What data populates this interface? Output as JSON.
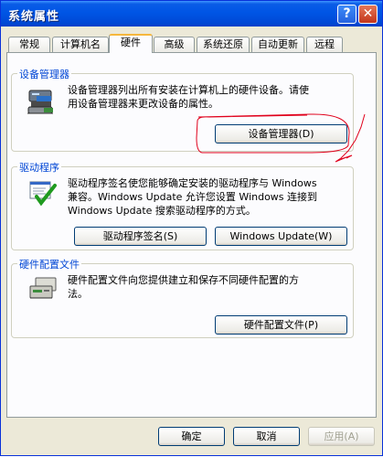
{
  "window": {
    "title": "系统属性",
    "help_glyph": "?",
    "close_glyph": "✕"
  },
  "tabs": [
    {
      "label": "常规"
    },
    {
      "label": "计算机名"
    },
    {
      "label": "硬件"
    },
    {
      "label": "高级"
    },
    {
      "label": "系统还原"
    },
    {
      "label": "自动更新"
    },
    {
      "label": "远程"
    }
  ],
  "active_tab": "硬件",
  "device_manager": {
    "title": "设备管理器",
    "description_line1": "设备管理器列出所有安装在计算机上的硬件设备。请使",
    "description_line2": "用设备管理器来更改设备的属性。",
    "button": "设备管理器(D)"
  },
  "drivers": {
    "title": "驱动程序",
    "description_line1": "驱动程序签名使您能够确定安装的驱动程序与 Windows",
    "description_line2": "兼容。Windows Update 允许您设置 Windows 连接到",
    "description_line3": "Windows Update 搜索驱动程序的方式。",
    "signing_button": "驱动程序签名(S)",
    "update_button": "Windows Update(W)"
  },
  "hardware_profiles": {
    "title": "硬件配置文件",
    "description_line1": "硬件配置文件向您提供建立和保存不同硬件配置的方",
    "description_line2": "法。",
    "button": "硬件配置文件(P)"
  },
  "footer": {
    "ok": "确定",
    "cancel": "取消",
    "apply": "应用(A)"
  },
  "colors": {
    "title_bar": "#0055e5",
    "group_title": "#0046d5",
    "annotation": "#e0001b"
  }
}
